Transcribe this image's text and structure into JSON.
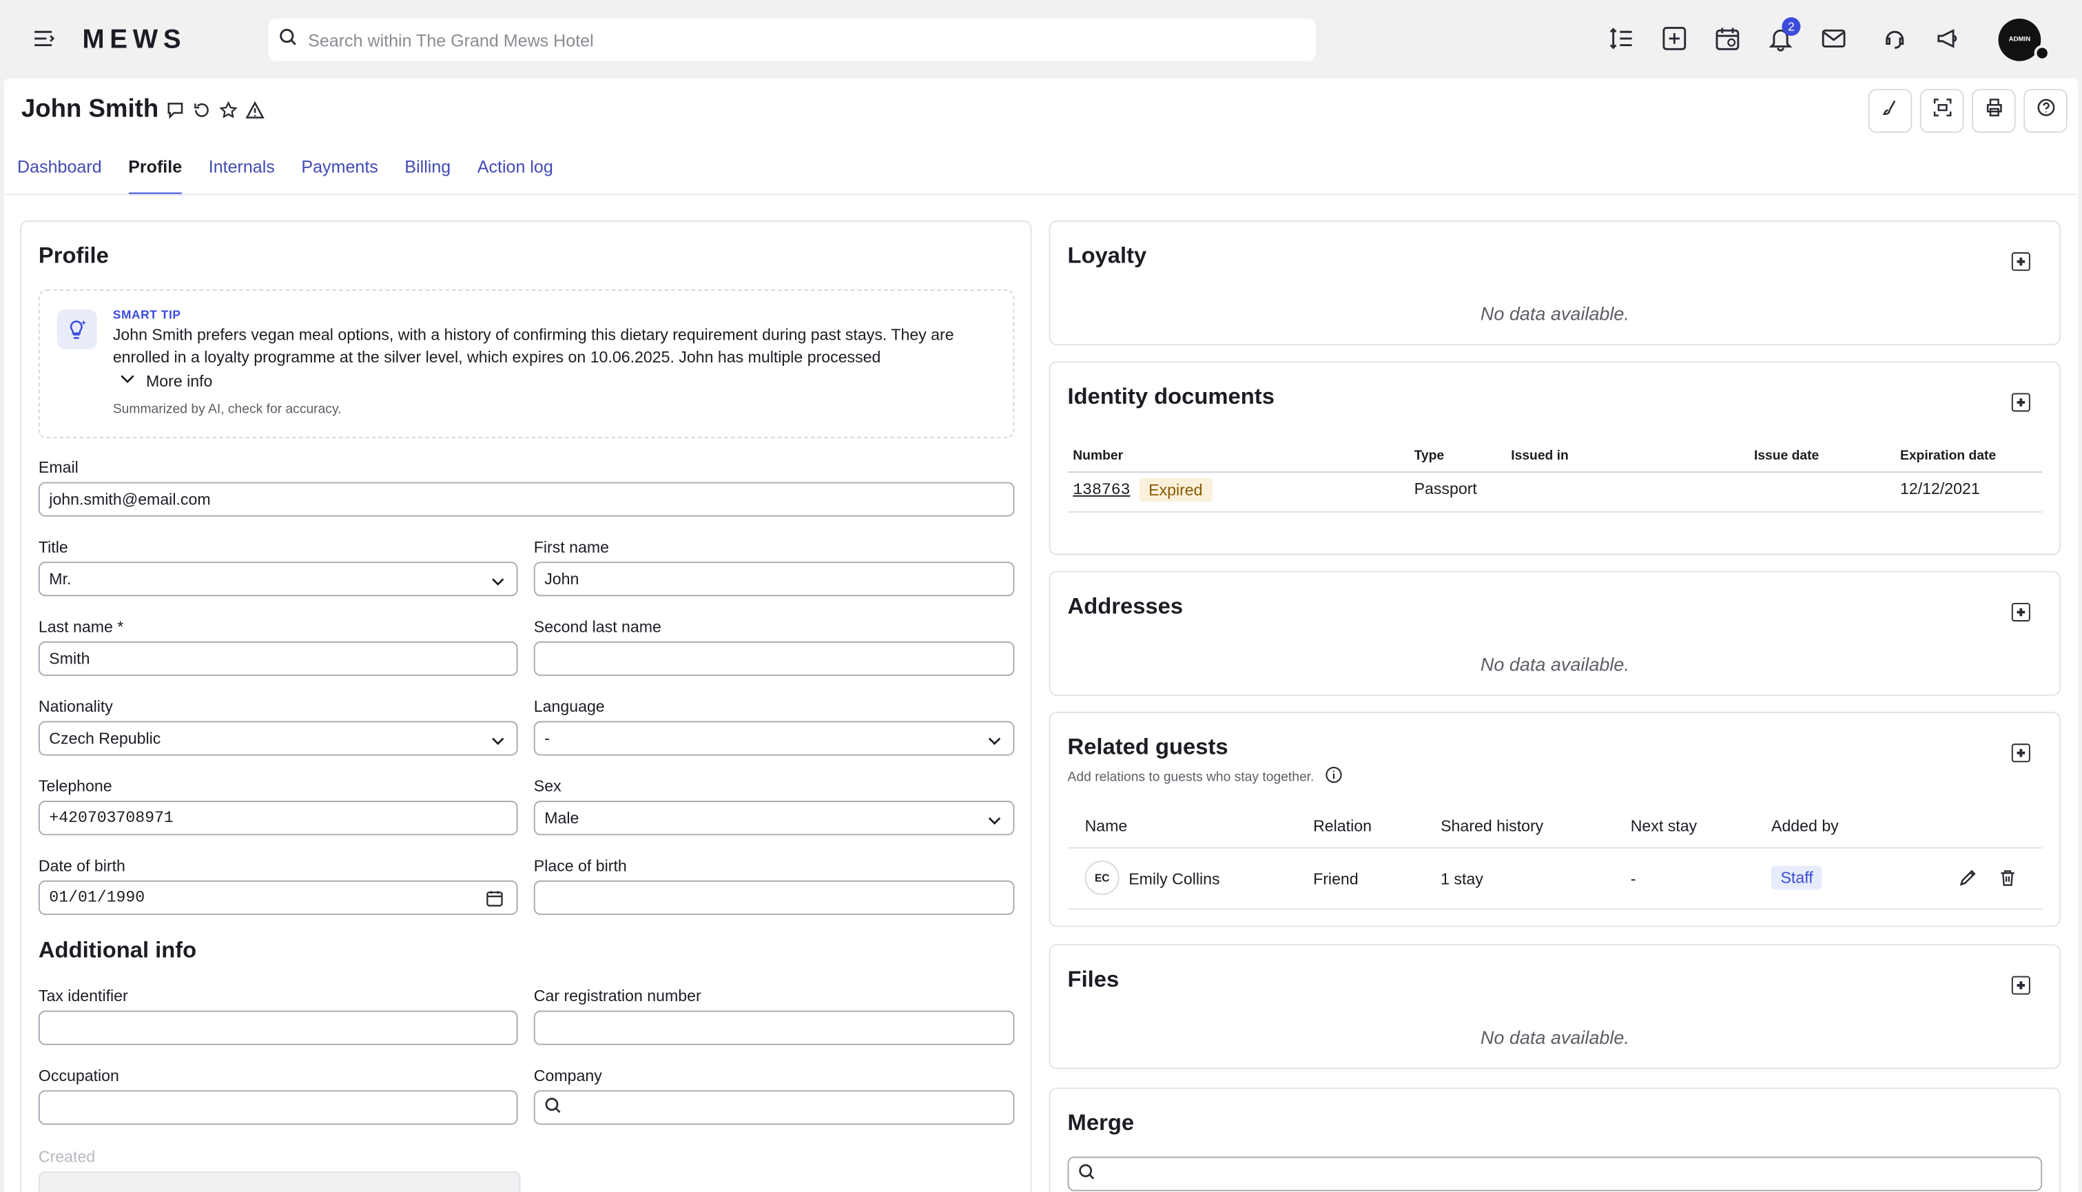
{
  "topbar": {
    "logo": "MEWS",
    "search_placeholder": "Search within The Grand Mews Hotel",
    "notification_count": "2",
    "avatar_text": "ADMIN"
  },
  "guest": {
    "name": "John Smith"
  },
  "tabs": [
    "Dashboard",
    "Profile",
    "Internals",
    "Payments",
    "Billing",
    "Action log"
  ],
  "active_tab": "Profile",
  "profile": {
    "title": "Profile",
    "smart_tip": {
      "label": "SMART TIP",
      "text": "John Smith prefers vegan meal options, with a history of confirming this dietary requirement during past stays. They are enrolled in a loyalty programme at the silver level, which expires on 10.06.2025. John has multiple processed",
      "more": "More info",
      "note": "Summarized by AI, check for accuracy."
    },
    "email_label": "Email",
    "email_value": "john.smith@email.com",
    "title_label": "Title",
    "title_value": "Mr.",
    "first_name_label": "First name",
    "first_name_value": "John",
    "last_name_label": "Last name *",
    "last_name_value": "Smith",
    "second_last_name_label": "Second last name",
    "nationality_label": "Nationality",
    "nationality_value": "Czech Republic",
    "language_label": "Language",
    "language_value": "-",
    "telephone_label": "Telephone",
    "telephone_value": "+420703708971",
    "sex_label": "Sex",
    "sex_value": "Male",
    "dob_label": "Date of birth",
    "dob_value": "01/01/1990",
    "pob_label": "Place of birth",
    "additional_title": "Additional info",
    "tax_label": "Tax identifier",
    "car_label": "Car registration number",
    "occupation_label": "Occupation",
    "company_label": "Company",
    "created_label": "Created"
  },
  "loyalty": {
    "title": "Loyalty",
    "empty": "No data available."
  },
  "identity": {
    "title": "Identity documents",
    "headers": [
      "Number",
      "Type",
      "Issued in",
      "Issue date",
      "Expiration date"
    ],
    "row": {
      "number": "138763",
      "status": "Expired",
      "type": "Passport",
      "expiration": "12/12/2021"
    }
  },
  "addresses": {
    "title": "Addresses",
    "empty": "No data available."
  },
  "related": {
    "title": "Related guests",
    "subtitle": "Add relations to guests who stay together.",
    "headers": [
      "Name",
      "Relation",
      "Shared history",
      "Next stay",
      "Added by"
    ],
    "row": {
      "initials": "EC",
      "name": "Emily Collins",
      "relation": "Friend",
      "history": "1 stay",
      "next": "-",
      "added_by": "Staff"
    }
  },
  "files": {
    "title": "Files",
    "empty": "No data available."
  },
  "merge": {
    "title": "Merge"
  },
  "colors": {
    "accent": "#3b4bdb",
    "link": "#414ab3",
    "expired_bg": "#fbf0d9",
    "staff_bg": "#e6ecfb"
  }
}
